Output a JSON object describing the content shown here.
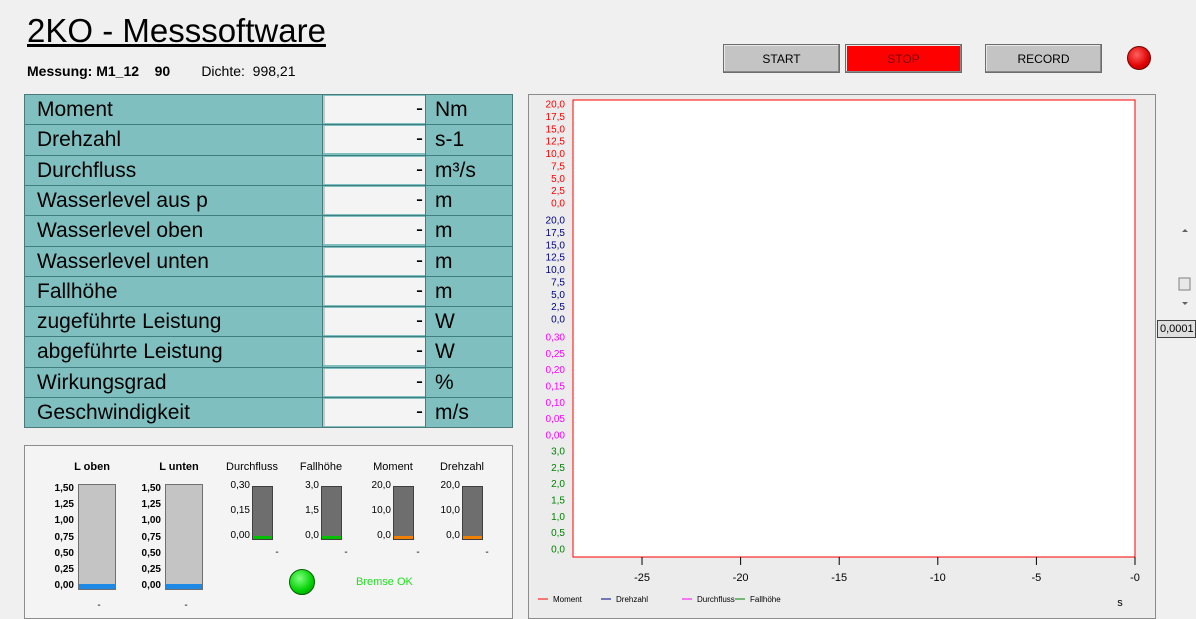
{
  "header": {
    "title": "2KO - Messsoftware",
    "measurement_label": "Messung: M1_12",
    "measurement_value": "90",
    "density_label": "Dichte:",
    "density_value": "998,21"
  },
  "toolbar": {
    "start_label": "START",
    "stop_label": "STOP",
    "record_label": "RECORD",
    "status_led_color": "#e00000"
  },
  "measurements": [
    {
      "name": "Moment",
      "value": "-",
      "unit": "Nm"
    },
    {
      "name": "Drehzahl",
      "value": "-",
      "unit": "s-1"
    },
    {
      "name": "Durchfluss",
      "value": "-",
      "unit": "m³/s"
    },
    {
      "name": "Wasserlevel aus p",
      "value": "-",
      "unit": "m"
    },
    {
      "name": "Wasserlevel oben",
      "value": "-",
      "unit": "m"
    },
    {
      "name": "Wasserlevel unten",
      "value": "-",
      "unit": "m"
    },
    {
      "name": "Fallhöhe",
      "value": "-",
      "unit": "m"
    },
    {
      "name": "zugeführte Leistung",
      "value": "-",
      "unit": "W"
    },
    {
      "name": "abgeführte Leistung",
      "value": "-",
      "unit": "W"
    },
    {
      "name": "Wirkungsgrad",
      "value": "-",
      "unit": "%"
    },
    {
      "name": "Geschwindigkeit",
      "value": "-",
      "unit": "m/s"
    }
  ],
  "gauges": {
    "tanks": [
      {
        "label": "L oben",
        "ticks": [
          "1,50",
          "1,25",
          "1,00",
          "0,75",
          "0,50",
          "0,25",
          "0,00"
        ],
        "level": 0.0,
        "value": "-"
      },
      {
        "label": "L unten",
        "ticks": [
          "1,50",
          "1,25",
          "1,00",
          "0,75",
          "0,50",
          "0,25",
          "0,00"
        ],
        "level": 0.0,
        "value": "-"
      }
    ],
    "small": [
      {
        "label": "Durchfluss",
        "ticks": [
          "0,30",
          "0,15",
          "0,00"
        ],
        "fill_color": "#00c000",
        "value": "-"
      },
      {
        "label": "Fallhöhe",
        "ticks": [
          "3,0",
          "1,5",
          "0,0"
        ],
        "fill_color": "#00c000",
        "value": "-"
      },
      {
        "label": "Moment",
        "ticks": [
          "20,0",
          "10,0",
          "0,0"
        ],
        "fill_color": "#f08000",
        "value": "-"
      },
      {
        "label": "Drehzahl",
        "ticks": [
          "20,0",
          "10,0",
          "0,0"
        ],
        "fill_color": "#f08000",
        "value": "-"
      }
    ],
    "brake_status": "Bremse OK",
    "brake_led_color": "#00d000"
  },
  "side_control": {
    "value": "0,0001"
  },
  "chart_data": {
    "type": "line",
    "title": "",
    "xlabel": "s",
    "xlim": [
      -28.5,
      0
    ],
    "xticks": [
      "-25",
      "-20",
      "-15",
      "-10",
      "-5",
      "-0"
    ],
    "xtick_values": [
      -25,
      -20,
      -15,
      -10,
      -5,
      0
    ],
    "series": [
      {
        "name": "Moment",
        "color": "#ff0000",
        "ylim": [
          0,
          20
        ],
        "yticks": [
          "20,0",
          "17,5",
          "15,0",
          "12,5",
          "10,0",
          "7,5",
          "5,0",
          "2,5",
          "0,0"
        ],
        "x": [],
        "y": []
      },
      {
        "name": "Drehzahl",
        "color": "#000080",
        "ylim": [
          0,
          20
        ],
        "yticks": [
          "20,0",
          "17,5",
          "15,0",
          "12,5",
          "10,0",
          "7,5",
          "5,0",
          "2,5",
          "0,0"
        ],
        "x": [],
        "y": []
      },
      {
        "name": "Durchfluss",
        "color": "#ff00ff",
        "ylim": [
          0,
          0.3
        ],
        "yticks": [
          "0,30",
          "0,25",
          "0,20",
          "0,15",
          "0,10",
          "0,05",
          "0,00"
        ],
        "x": [],
        "y": []
      },
      {
        "name": "Fallhöhe",
        "color": "#008000",
        "ylim": [
          0,
          3
        ],
        "yticks": [
          "3,0",
          "2,5",
          "2,0",
          "1,5",
          "1,0",
          "0,5",
          "0,0"
        ],
        "x": [],
        "y": []
      }
    ],
    "grid": false,
    "legend_position": "bottom-left"
  }
}
